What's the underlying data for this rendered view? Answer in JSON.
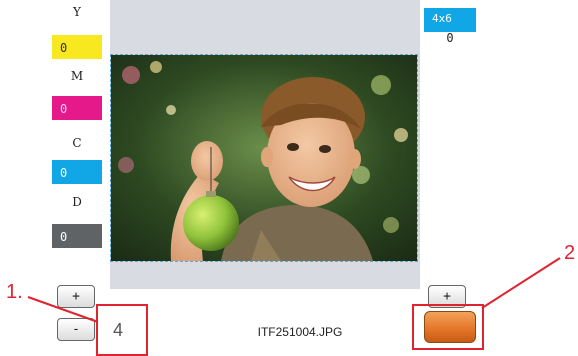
{
  "channels": [
    {
      "letter": "Y",
      "value": "0",
      "color": "#f8e820"
    },
    {
      "letter": "M",
      "value": "0",
      "color": "#e5198a"
    },
    {
      "letter": "C",
      "value": "0",
      "color": "#11a6e6"
    },
    {
      "letter": "D",
      "value": "0",
      "color": "#5f6366"
    }
  ],
  "preview": {
    "filename": "ITF251004.JPG",
    "panel_color": "#d8dbe2"
  },
  "copies": {
    "plus_label": "+",
    "minus_label": "-",
    "value": "4"
  },
  "paper_size": {
    "label": "4x6",
    "value": "0",
    "plus_label": "+"
  },
  "annotations": {
    "label_1": "1.",
    "label_2": "2",
    "color": "#e0242f"
  },
  "print_button": {
    "color": "#e4772a"
  }
}
